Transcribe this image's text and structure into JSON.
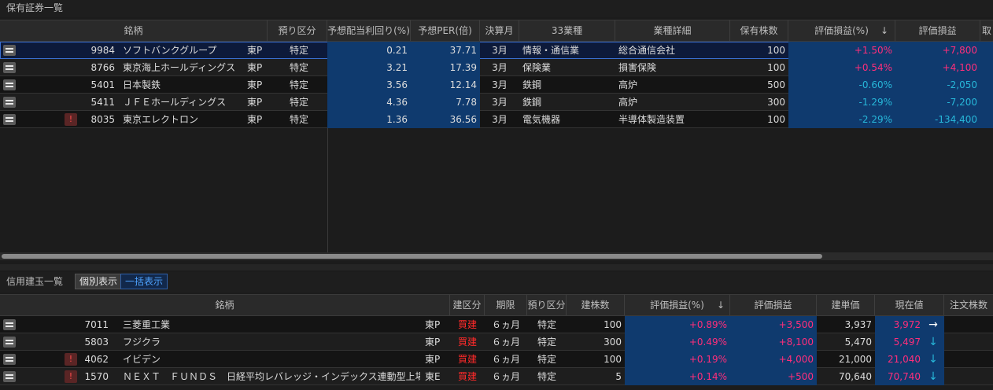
{
  "holdings": {
    "title": "保有証券一覧",
    "headers": [
      "銘柄",
      "預り区分",
      "予想配当利回り(%)",
      "予想PER(倍)",
      "決算月",
      "33業種",
      "業種詳細",
      "保有株数",
      "評価損益(%)",
      "評価損益",
      "取"
    ],
    "sort_icon": "↓",
    "rows": [
      {
        "code": "9984",
        "name": "ソフトバンクグループ",
        "market": "東P",
        "account": "特定",
        "yield": "0.21",
        "per": "37.71",
        "month": "3月",
        "sector": "情報・通信業",
        "detail": "総合通信会社",
        "shares": "100",
        "pl_pct": "+1.50%",
        "pl": "+7,800",
        "dir": "pos",
        "warn": ""
      },
      {
        "code": "8766",
        "name": "東京海上ホールディングス",
        "market": "東P",
        "account": "特定",
        "yield": "3.21",
        "per": "17.39",
        "month": "3月",
        "sector": "保険業",
        "detail": "損害保険",
        "shares": "100",
        "pl_pct": "+0.54%",
        "pl": "+4,100",
        "dir": "pos",
        "warn": ""
      },
      {
        "code": "5401",
        "name": "日本製鉄",
        "market": "東P",
        "account": "特定",
        "yield": "3.56",
        "per": "12.14",
        "month": "3月",
        "sector": "鉄鋼",
        "detail": "高炉",
        "shares": "500",
        "pl_pct": "-0.60%",
        "pl": "-2,050",
        "dir": "neg",
        "warn": ""
      },
      {
        "code": "5411",
        "name": "ＪＦＥホールディングス",
        "market": "東P",
        "account": "特定",
        "yield": "4.36",
        "per": "7.78",
        "month": "3月",
        "sector": "鉄鋼",
        "detail": "高炉",
        "shares": "300",
        "pl_pct": "-1.29%",
        "pl": "-7,200",
        "dir": "neg",
        "warn": ""
      },
      {
        "code": "8035",
        "name": "東京エレクトロン",
        "market": "東P",
        "account": "特定",
        "yield": "1.36",
        "per": "36.56",
        "month": "3月",
        "sector": "電気機器",
        "detail": "半導体製造装置",
        "shares": "100",
        "pl_pct": "-2.29%",
        "pl": "-134,400",
        "dir": "neg",
        "warn": "!"
      }
    ]
  },
  "credit": {
    "title": "信用建玉一覧",
    "tab_individual": "個別表示",
    "tab_bulk": "一括表示",
    "headers": [
      "銘柄",
      "建区分",
      "期限",
      "預り区分",
      "建株数",
      "評価損益(%)",
      "評価損益",
      "建単価",
      "現在値",
      "注文株数"
    ],
    "sort_icon": "↓",
    "rows": [
      {
        "code": "7011",
        "name": "三菱重工業",
        "market": "東P",
        "type": "買建",
        "term": "６ヵ月",
        "account": "特定",
        "shares": "100",
        "pl_pct": "+0.89%",
        "pl": "+3,500",
        "unit": "3,937",
        "price": "3,972",
        "arrow": "→",
        "warn": ""
      },
      {
        "code": "5803",
        "name": "フジクラ",
        "market": "東P",
        "type": "買建",
        "term": "６ヵ月",
        "account": "特定",
        "shares": "300",
        "pl_pct": "+0.49%",
        "pl": "+8,100",
        "unit": "5,470",
        "price": "5,497",
        "arrow": "↓",
        "warn": ""
      },
      {
        "code": "4062",
        "name": "イビデン",
        "market": "東P",
        "type": "買建",
        "term": "６ヵ月",
        "account": "特定",
        "shares": "100",
        "pl_pct": "+0.19%",
        "pl": "+4,000",
        "unit": "21,000",
        "price": "21,040",
        "arrow": "↓",
        "warn": "!"
      },
      {
        "code": "1570",
        "name": "ＮＥＸＴ　ＦＵＮＤＳ　日経平均レバレッジ・インデックス連動型上場投信",
        "market": "東E",
        "type": "買建",
        "term": "６ヵ月",
        "account": "特定",
        "shares": "5",
        "pl_pct": "+0.14%",
        "pl": "+500",
        "unit": "70,640",
        "price": "70,740",
        "arrow": "↓",
        "warn": "!"
      }
    ]
  }
}
